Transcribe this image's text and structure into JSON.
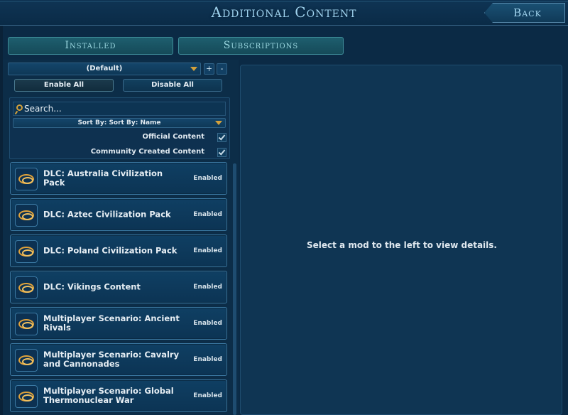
{
  "header": {
    "title": "Additional Content",
    "back_label": "Back"
  },
  "tabs": [
    {
      "label": "Installed"
    },
    {
      "label": "Subscriptions"
    }
  ],
  "config": {
    "selected": "(Default)",
    "add_label": "+",
    "remove_label": "-"
  },
  "actions": {
    "enable_all": "Enable All",
    "disable_all": "Disable All"
  },
  "search": {
    "placeholder": "Search..."
  },
  "sort": {
    "label": "Sort By: Sort By: Name"
  },
  "filters": {
    "official": {
      "label": "Official Content",
      "checked": true
    },
    "community": {
      "label": "Community Created Content",
      "checked": true
    }
  },
  "mods": [
    {
      "name": "DLC: Australia Civilization Pack",
      "status": "Enabled",
      "icon": "dlc-icon"
    },
    {
      "name": "DLC: Aztec Civilization Pack",
      "status": "Enabled",
      "icon": "dlc-icon"
    },
    {
      "name": "DLC: Poland Civilization Pack",
      "status": "Enabled",
      "icon": "dlc-icon"
    },
    {
      "name": "DLC: Vikings Content",
      "status": "Enabled",
      "icon": "dlc-icon"
    },
    {
      "name": "Multiplayer Scenario: Ancient Rivals",
      "status": "Enabled",
      "icon": "dlc-icon"
    },
    {
      "name": "Multiplayer Scenario: Cavalry and Cannonades",
      "status": "Enabled",
      "icon": "dlc-icon"
    },
    {
      "name": "Multiplayer Scenario: Global Thermonuclear War",
      "status": "Enabled",
      "icon": "dlc-icon"
    }
  ],
  "details": {
    "message": "Select a mod to the left to view details."
  },
  "colors": {
    "background": "#0b2a45",
    "accent_gold": "#d4a13b",
    "title_blue": "#9fd3ef",
    "tab_teal": "#1e5e6e"
  }
}
